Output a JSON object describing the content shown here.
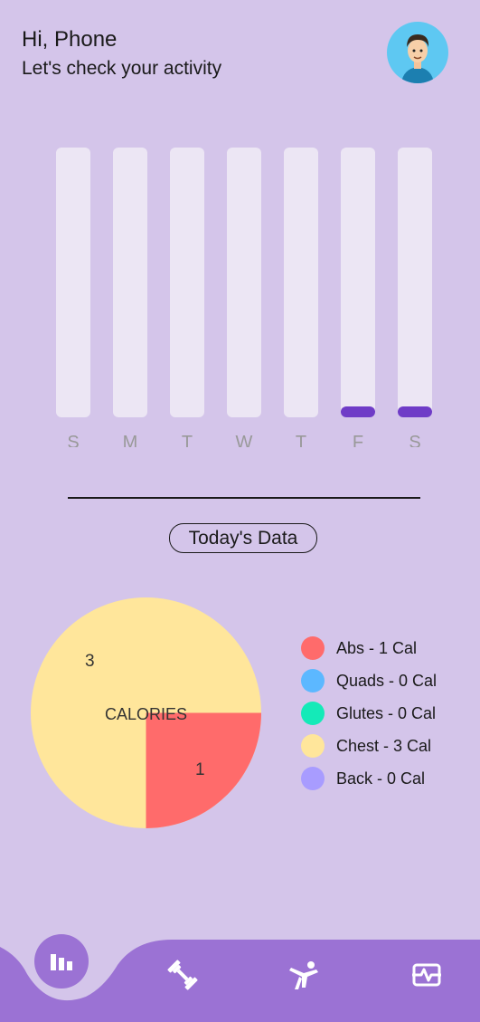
{
  "header": {
    "greeting": "Hi, Phone",
    "subtitle": "Let's check your activity"
  },
  "weekly_chart": {
    "days": [
      "S",
      "M",
      "T",
      "W",
      "T",
      "F",
      "S"
    ],
    "filled": [
      0,
      0,
      0,
      0,
      0,
      1,
      1
    ],
    "track_color": "#ece6f4",
    "fill_color": "#6f3cc7"
  },
  "today_button": "Today's Data",
  "chart_data": {
    "type": "pie",
    "title": "CALORIES",
    "slices": [
      {
        "label": "Abs",
        "value": 1,
        "color": "#ff6b6b"
      },
      {
        "label": "Quads",
        "value": 0,
        "color": "#5cb8ff"
      },
      {
        "label": "Glutes",
        "value": 0,
        "color": "#14eab8"
      },
      {
        "label": "Chest",
        "value": 3,
        "color": "#ffe69b"
      },
      {
        "label": "Back",
        "value": 0,
        "color": "#a89cff"
      }
    ],
    "data_labels": [
      "1",
      "3"
    ]
  },
  "legend": [
    {
      "text": "Abs - 1 Cal",
      "color": "#ff6b6b"
    },
    {
      "text": "Quads - 0 Cal",
      "color": "#5cb8ff"
    },
    {
      "text": "Glutes - 0 Cal",
      "color": "#14eab8"
    },
    {
      "text": "Chest - 3 Cal",
      "color": "#ffe69b"
    },
    {
      "text": "Back - 0 Cal",
      "color": "#a89cff"
    }
  ],
  "nav": {
    "items": [
      {
        "icon": "stats-icon",
        "active": true
      },
      {
        "icon": "dumbbell-icon",
        "active": false
      },
      {
        "icon": "stretch-icon",
        "active": false
      },
      {
        "icon": "activity-icon",
        "active": false
      }
    ],
    "bar_color": "#9b72d4"
  }
}
